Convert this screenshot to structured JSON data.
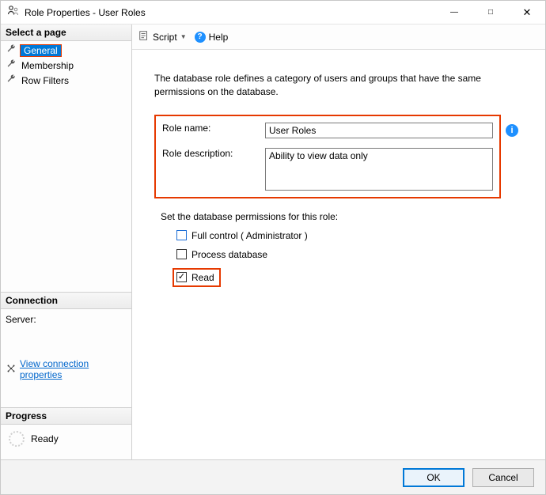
{
  "window": {
    "title": "Role Properties - User Roles"
  },
  "sidebar": {
    "select_page_header": "Select a page",
    "items": [
      {
        "label": "General"
      },
      {
        "label": "Membership"
      },
      {
        "label": "Row Filters"
      }
    ],
    "connection_header": "Connection",
    "server_label": "Server:",
    "view_connection": "View connection properties",
    "progress_header": "Progress",
    "progress_status": "Ready"
  },
  "toolbar": {
    "script_label": "Script",
    "help_label": "Help"
  },
  "main": {
    "intro": "The database role defines a category of users and groups that have the same permissions on the database.",
    "role_name_label": "Role name:",
    "role_name_value": "User Roles",
    "role_desc_label": "Role description:",
    "role_desc_value": "Ability to view data only",
    "permissions_label": "Set the database permissions for this role:",
    "perm_full": "Full control ( Administrator )",
    "perm_process": "Process database",
    "perm_read": "Read"
  },
  "footer": {
    "ok": "OK",
    "cancel": "Cancel"
  }
}
